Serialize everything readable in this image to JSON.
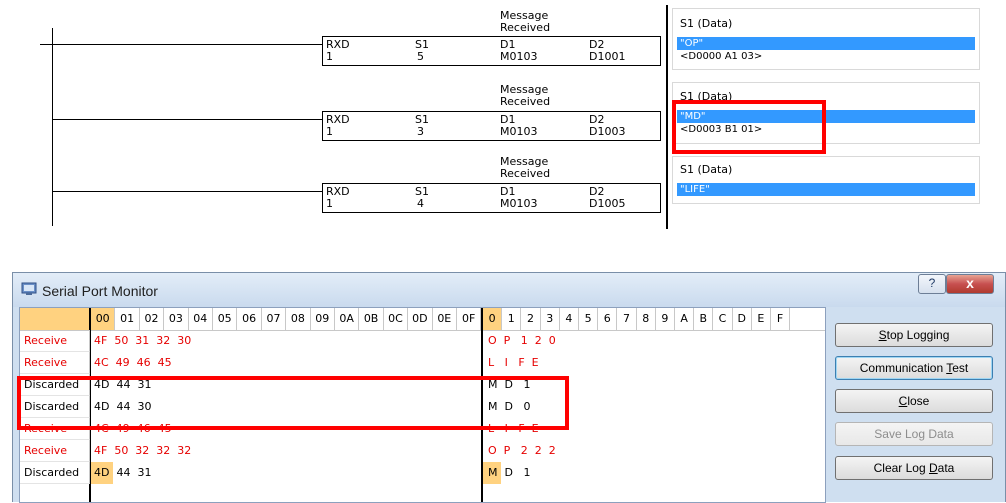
{
  "ladder": {
    "rungs": [
      {
        "message_title": "Message Received",
        "headers": [
          "RXD",
          "S1",
          "D1",
          "D2"
        ],
        "values": [
          "1",
          "5",
          "M0103",
          "D1001"
        ],
        "watch_title": "S1 (Data)",
        "watch_selected": "\"OP\"",
        "watch_detail": "<D0000 A1 03>"
      },
      {
        "message_title": "Message Received",
        "headers": [
          "RXD",
          "S1",
          "D1",
          "D2"
        ],
        "values": [
          "1",
          "3",
          "M0103",
          "D1003"
        ],
        "watch_title": "S1 (Data)",
        "watch_selected": "\"MD\"",
        "watch_detail": "<D0003 B1 01>"
      },
      {
        "message_title": "Message Received",
        "headers": [
          "RXD",
          "S1",
          "D1",
          "D2"
        ],
        "values": [
          "1",
          "4",
          "M0103",
          "D1005"
        ],
        "watch_title": "S1 (Data)",
        "watch_selected": "\"LIFE\"",
        "watch_detail": ""
      }
    ]
  },
  "monitor": {
    "title": "Serial Port Monitor",
    "help_label": "?",
    "close_label": "x",
    "hex_headers": [
      "00",
      "01",
      "02",
      "03",
      "04",
      "05",
      "06",
      "07",
      "08",
      "09",
      "0A",
      "0B",
      "0C",
      "0D",
      "0E",
      "0F"
    ],
    "ascii_headers": [
      "0",
      "1",
      "2",
      "3",
      "4",
      "5",
      "6",
      "7",
      "8",
      "9",
      "A",
      "B",
      "C",
      "D",
      "E",
      "F"
    ],
    "rows": [
      {
        "type": "Receive",
        "hex": "4F  50  31  32  30",
        "ascii": "O  P   1  2  0",
        "color": "#e60000"
      },
      {
        "type": "Receive",
        "hex": "4C  49  46  45",
        "ascii": "L   I   F  E",
        "color": "#e60000"
      },
      {
        "type": "Discarded",
        "hex": "4D  44  31",
        "ascii": "M  D   1",
        "color": "#000000"
      },
      {
        "type": "Discarded",
        "hex": "4D  44  30",
        "ascii": "M  D   0",
        "color": "#000000"
      },
      {
        "type": "Receive",
        "hex": "4C  49  46  45",
        "ascii": "L   I   F  E",
        "color": "#e60000"
      },
      {
        "type": "Receive",
        "hex": "4F  50  32  32  32",
        "ascii": "O  P   2  2  2",
        "color": "#e60000"
      },
      {
        "type": "Discarded",
        "hex": "4D  44  31",
        "ascii": "M  D   1",
        "color": "#000000"
      }
    ],
    "buttons": {
      "stop_logging": {
        "pre": "",
        "key": "S",
        "post": "top Logging"
      },
      "communication_test": {
        "pre": "Communication ",
        "key": "T",
        "post": "est"
      },
      "close": {
        "pre": "",
        "key": "C",
        "post": "lose"
      },
      "save_log": "Save Log Data",
      "clear_log": {
        "pre": "Clear Log ",
        "key": "D",
        "post": "ata"
      }
    }
  },
  "colors": {
    "highlight_red": "#ff0000",
    "selected_blue": "#3399ff",
    "header_selected": "#ffd280",
    "receive_red": "#e60000"
  }
}
